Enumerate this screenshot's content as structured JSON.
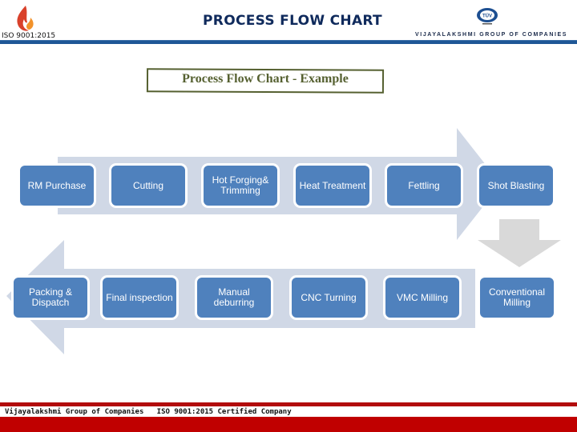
{
  "header": {
    "title": "PROCESS FLOW  CHART",
    "iso_label": "ISO 9001:2015",
    "company_name": "VIJAYALAKSHMI GROUP OF COMPANIES",
    "logo_left": "flame-logo",
    "logo_right": "tuv-certification-logo",
    "tuv_text": "TÜV"
  },
  "subtitle": "Process Flow Chart - Example",
  "flow": {
    "top_row": [
      {
        "label": "RM Purchase"
      },
      {
        "label": "Cutting"
      },
      {
        "label": "Hot Forging& Trimming"
      },
      {
        "label": "Heat Treatment"
      },
      {
        "label": "Fettling"
      },
      {
        "label": "Shot Blasting"
      }
    ],
    "bottom_row": [
      {
        "label": "Packing & Dispatch"
      },
      {
        "label": "Final inspection"
      },
      {
        "label": "Manual deburring"
      },
      {
        "label": "CNC Turning"
      },
      {
        "label": "VMC Milling"
      },
      {
        "label": "Conventional Milling"
      }
    ],
    "top_direction": "right",
    "bottom_direction": "left",
    "connector_direction": "down"
  },
  "colors": {
    "step_fill": "#4f81bd",
    "arrow_band": "#d0d8e6",
    "down_arrow": "#d9d9d9",
    "title_color": "#0f2a5c",
    "header_line": "#1f5796",
    "subtitle_color": "#556030",
    "footer_red": "#c00000"
  },
  "footer": {
    "company": "Vijayalakshmi Group of Companies",
    "certification": "ISO 9001:2015 Certified Company"
  }
}
